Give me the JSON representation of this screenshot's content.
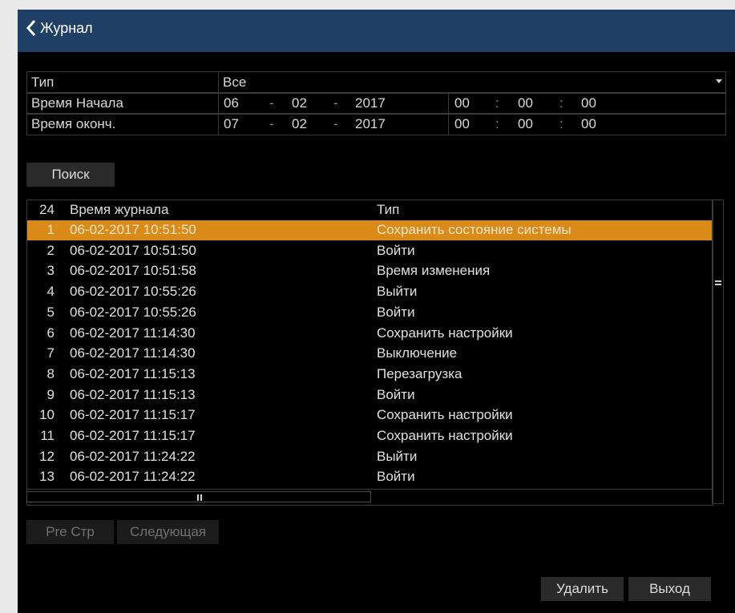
{
  "header": {
    "title": "Журнал",
    "icon": "chevron-left-icon"
  },
  "filters": {
    "type_label": "Тип",
    "type_value": "Все",
    "start_label": "Время Начала",
    "start": {
      "day": "06",
      "month": "02",
      "year": "2017",
      "hh": "00",
      "mm": "00",
      "ss": "00"
    },
    "end_label": "Время оконч.",
    "end": {
      "day": "07",
      "month": "02",
      "year": "2017",
      "hh": "00",
      "mm": "00",
      "ss": "00"
    },
    "date_sep": "-",
    "time_sep": ":"
  },
  "search_button": "Поиск",
  "table": {
    "count": "24",
    "col_time": "Время журнала",
    "col_type": "Тип",
    "selected_row": 1,
    "rows": [
      {
        "n": "1",
        "time": "06-02-2017 10:51:50",
        "type": "Сохранить состояние системы"
      },
      {
        "n": "2",
        "time": "06-02-2017 10:51:50",
        "type": "Войти"
      },
      {
        "n": "3",
        "time": "06-02-2017 10:51:58",
        "type": "Время изменения"
      },
      {
        "n": "4",
        "time": "06-02-2017 10:55:26",
        "type": "Выйти"
      },
      {
        "n": "5",
        "time": "06-02-2017 10:55:26",
        "type": "Войти"
      },
      {
        "n": "6",
        "time": "06-02-2017 11:14:30",
        "type": "Сохранить настройки"
      },
      {
        "n": "7",
        "time": "06-02-2017 11:14:30",
        "type": "Выключение"
      },
      {
        "n": "8",
        "time": "06-02-2017 11:15:13",
        "type": "Перезагрузка"
      },
      {
        "n": "9",
        "time": "06-02-2017 11:15:13",
        "type": "Войти"
      },
      {
        "n": "10",
        "time": "06-02-2017 11:15:17",
        "type": "Сохранить настройки"
      },
      {
        "n": "11",
        "time": "06-02-2017 11:15:17",
        "type": "Сохранить настройки"
      },
      {
        "n": "12",
        "time": "06-02-2017 11:24:22",
        "type": "Выйти"
      },
      {
        "n": "13",
        "time": "06-02-2017 11:24:22",
        "type": "Войти"
      }
    ]
  },
  "pager": {
    "prev": "Pre Стр",
    "next": "Следующая"
  },
  "footer": {
    "delete": "Удалить",
    "exit": "Выход"
  },
  "colors": {
    "titlebar": "#1f3f66",
    "selection": "#d98a17",
    "background": "#000000"
  }
}
